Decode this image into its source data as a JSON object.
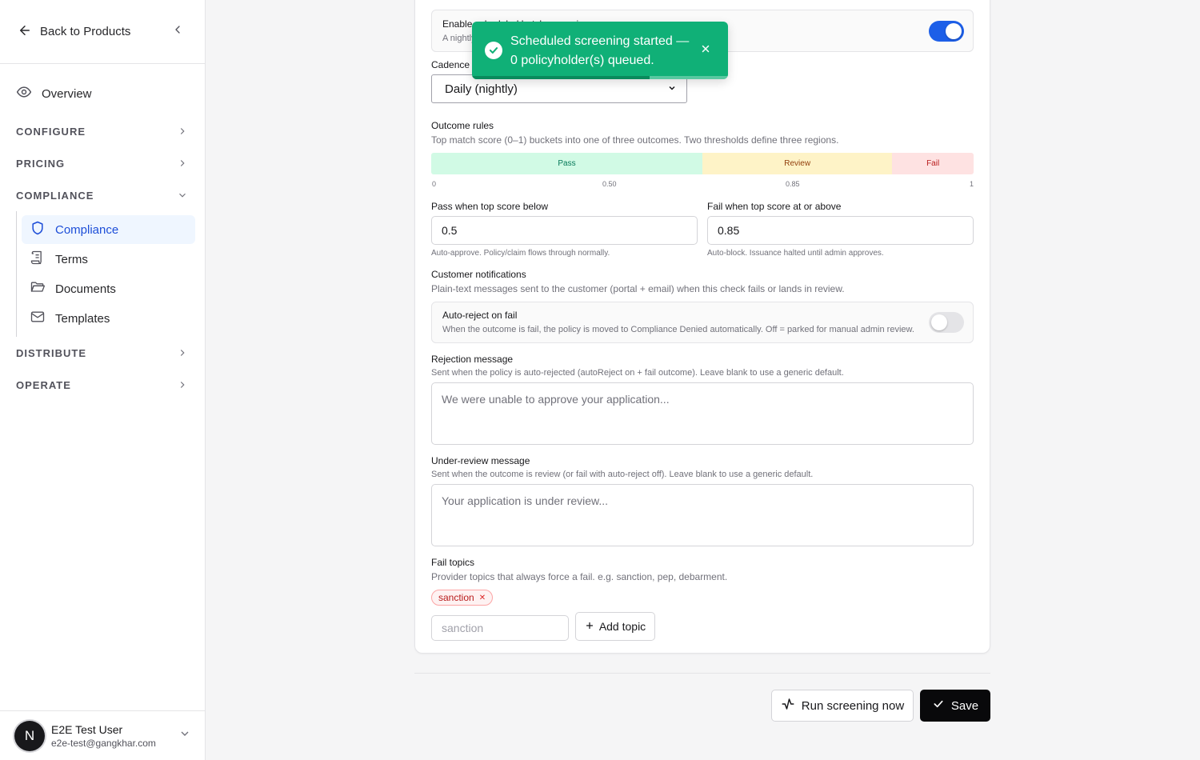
{
  "sidebar": {
    "back_label": "Back to Products",
    "overview_label": "Overview",
    "sections": {
      "configure": "CONFIGURE",
      "pricing": "PRICING",
      "compliance": "COMPLIANCE",
      "distribute": "DISTRIBUTE",
      "operate": "OPERATE"
    },
    "compliance_items": [
      {
        "label": "Compliance",
        "icon": "shield-icon",
        "active": true
      },
      {
        "label": "Terms",
        "icon": "scroll-icon",
        "active": false
      },
      {
        "label": "Documents",
        "icon": "folder-icon",
        "active": false
      },
      {
        "label": "Templates",
        "icon": "mail-icon",
        "active": false
      }
    ],
    "user": {
      "initial": "N",
      "name": "E2E Test User",
      "email": "e2e-test@gangkhar.com"
    }
  },
  "scheduled": {
    "title": "Enable scheduled batch screening",
    "desc": "A nightly",
    "enabled": true
  },
  "cadence": {
    "label": "Cadence",
    "value": "Daily (nightly)"
  },
  "outcome": {
    "title": "Outcome rules",
    "desc": "Top match score (0–1) buckets into one of three outcomes. Two thresholds define three regions.",
    "pass_threshold": 0.5,
    "fail_threshold": 0.85,
    "bands": {
      "pass": "Pass",
      "review": "Review",
      "fail": "Fail"
    },
    "ticks": {
      "t0": "0",
      "t1": "0.50",
      "t2": "0.85",
      "t3": "1"
    },
    "colors": {
      "pass": "#d1fae5",
      "review": "#fef3c7",
      "fail": "#fee2e2",
      "pass_text": "#047857",
      "review_text": "#92400e",
      "fail_text": "#b91c1c"
    }
  },
  "pass_field": {
    "label": "Pass when top score below",
    "value": "0.5",
    "hint": "Auto-approve. Policy/claim flows through normally."
  },
  "fail_field": {
    "label": "Fail when top score at or above",
    "value": "0.85",
    "hint": "Auto-block. Issuance halted until admin approves."
  },
  "notifications": {
    "title": "Customer notifications",
    "desc": "Plain-text messages sent to the customer (portal + email) when this check fails or lands in review."
  },
  "auto_reject": {
    "title": "Auto-reject on fail",
    "desc": "When the outcome is fail, the policy is moved to Compliance Denied automatically. Off = parked for manual admin review.",
    "enabled": false
  },
  "rejection": {
    "label": "Rejection message",
    "hint": "Sent when the policy is auto-rejected (autoReject on + fail outcome). Leave blank to use a generic default.",
    "placeholder": "We were unable to approve your application..."
  },
  "review_msg": {
    "label": "Under-review message",
    "hint": "Sent when the outcome is review (or fail with auto-reject off). Leave blank to use a generic default.",
    "placeholder": "Your application is under review..."
  },
  "fail_topics": {
    "label": "Fail topics",
    "hint": "Provider topics that always force a fail. e.g. sanction, pep, debarment.",
    "chips": [
      "sanction"
    ],
    "input_placeholder": "sanction",
    "add_label": "Add topic"
  },
  "actions": {
    "run_label": "Run screening now",
    "save_label": "Save"
  },
  "toast": {
    "message": "Scheduled screening started — 0 policyholder(s) queued.",
    "progress": 0.69
  }
}
